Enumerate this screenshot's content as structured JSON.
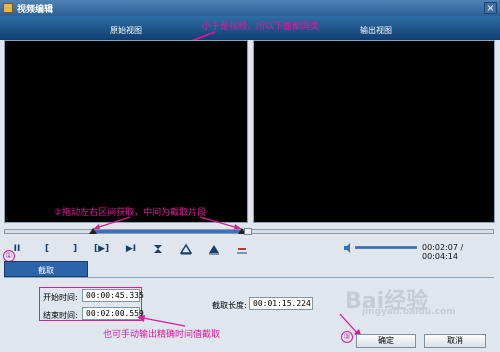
{
  "window": {
    "title": "视频编辑",
    "close_glyph": "×"
  },
  "views": {
    "original_label": "原始视图",
    "output_label": "输出视图"
  },
  "annotations": {
    "top": "小于是视频，所以下面都同类",
    "slider": "②拖动左右区间获取，中间为截取片段",
    "manual": "也可手动输出精确时间值截取",
    "step1": "①",
    "step3": "③"
  },
  "controls": {
    "pause_glyph": "II",
    "mark_in_glyph": "[",
    "mark_out_glyph": "]",
    "play_glyph": "▶",
    "next_glyph": "▶I",
    "icons": [
      "pause-icon",
      "mark-in-icon",
      "mark-out-icon",
      "play-range-icon",
      "next-frame-icon",
      "split-icon",
      "jump-start-icon",
      "jump-end-icon",
      "undo-icon",
      "volume-icon"
    ]
  },
  "playback": {
    "time_display": "00:02:07 / 00:04:14",
    "volume_level": 0.95,
    "range_start": 0.18,
    "range_end": 0.48
  },
  "tab": {
    "label": "截取"
  },
  "trim": {
    "start_label": "开始时间:",
    "start_value": "00:00:45.335",
    "end_label": "结束时间:",
    "end_value": "00:02:00.559",
    "length_label": "截取长度:",
    "length_value": "00:01:15.224"
  },
  "buttons": {
    "ok": "确定",
    "cancel": "取消"
  },
  "watermark": {
    "text": "Bai经验",
    "sub": "jingyan.baidu.com"
  },
  "colors": {
    "accent": "#e0189c",
    "header": "#1f5a93",
    "progress": "#3a6fc4"
  }
}
